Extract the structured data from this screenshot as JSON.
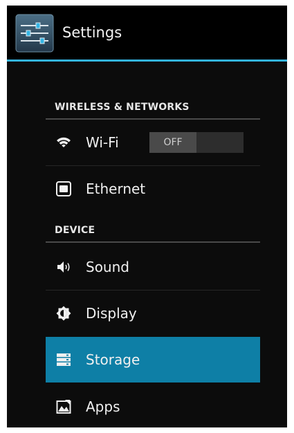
{
  "action_bar": {
    "title": "Settings",
    "icon": "settings-sliders-icon",
    "accent_color": "#33b5e5"
  },
  "sections": [
    {
      "header": "WIRELESS & NETWORKS",
      "items": [
        {
          "label": "Wi-Fi",
          "icon": "wifi-icon",
          "toggle": {
            "state": "OFF"
          }
        },
        {
          "label": "Ethernet",
          "icon": "ethernet-icon"
        }
      ]
    },
    {
      "header": "DEVICE",
      "items": [
        {
          "label": "Sound",
          "icon": "sound-icon"
        },
        {
          "label": "Display",
          "icon": "display-icon"
        },
        {
          "label": "Storage",
          "icon": "storage-icon",
          "selected": true
        },
        {
          "label": "Apps",
          "icon": "apps-icon"
        }
      ]
    }
  ],
  "colors": {
    "background": "#0c0c0c",
    "selected_row": "#0e7fa6",
    "text": "#f0f0f0"
  }
}
